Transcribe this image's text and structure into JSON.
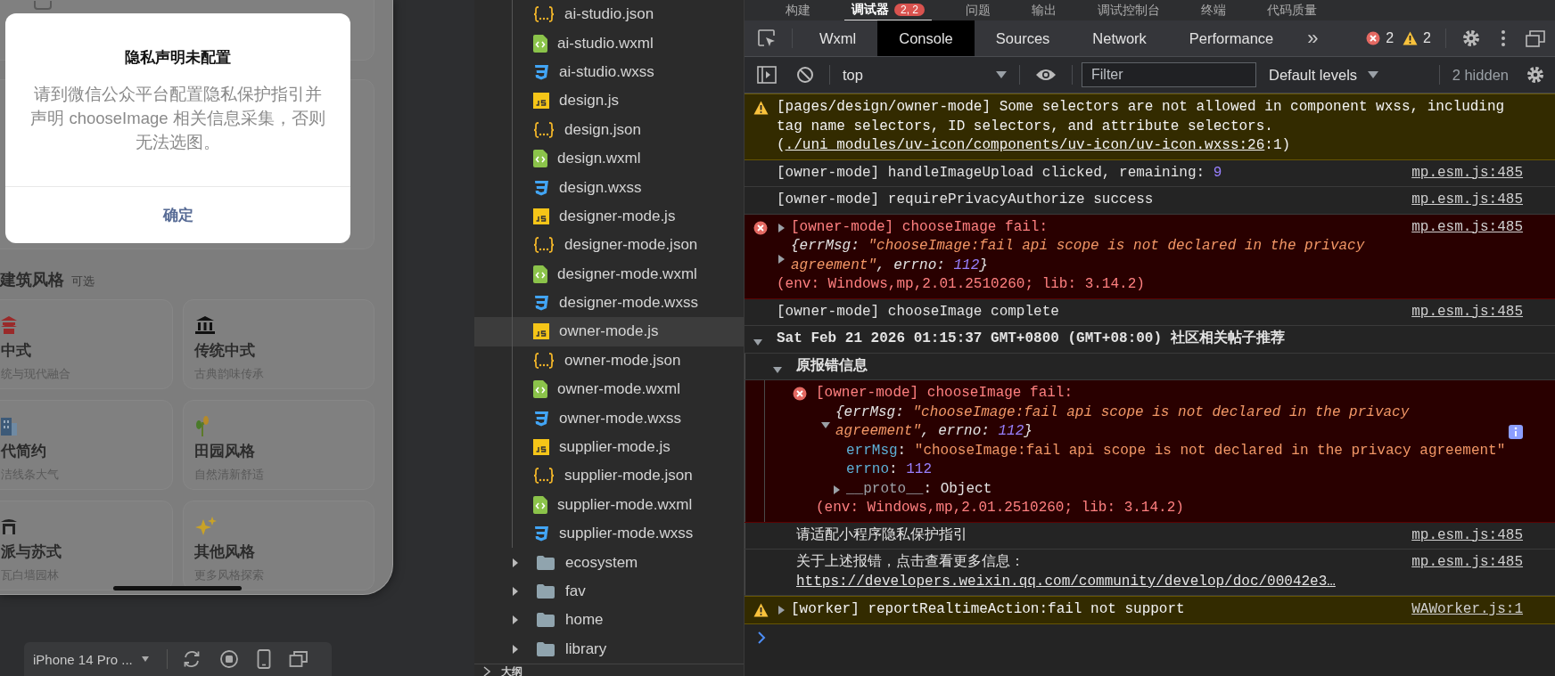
{
  "ide_tabs": [
    {
      "label": "构建",
      "selected": false
    },
    {
      "label": "调试器",
      "selected": true,
      "badge": "2, 2"
    },
    {
      "label": "问题",
      "selected": false
    },
    {
      "label": "输出",
      "selected": false
    },
    {
      "label": "调试控制台",
      "selected": false
    },
    {
      "label": "终端",
      "selected": false
    },
    {
      "label": "代码质量",
      "selected": false
    }
  ],
  "simulator": {
    "section_title": "建筑风格",
    "section_hint": "可选",
    "styles": [
      {
        "title": "中式",
        "subtitle": "统与现代融合",
        "kind": "pagoda"
      },
      {
        "title": "传统中式",
        "subtitle": "古典韵味传承",
        "kind": "temple"
      },
      {
        "title": "代简约",
        "subtitle": "洁线条大气",
        "kind": "building"
      },
      {
        "title": "田园风格",
        "subtitle": "自然清新舒适",
        "kind": "plant"
      },
      {
        "title": "派与苏式",
        "subtitle": "瓦白墙园林",
        "kind": "garden"
      },
      {
        "title": "其他风格",
        "subtitle": "更多风格探索",
        "kind": "sparkles"
      }
    ],
    "dialog": {
      "title": "隐私声明未配置",
      "message": "请到微信公众平台配置隐私保护指引并声明 chooseImage 相关信息采集，否则无法选图。",
      "button": "确定"
    },
    "device": "iPhone 14 Pro ..."
  },
  "file_tree": [
    {
      "name": "ai-studio.json",
      "kind": "json",
      "selected": false
    },
    {
      "name": "ai-studio.wxml",
      "kind": "wxml",
      "selected": false
    },
    {
      "name": "ai-studio.wxss",
      "kind": "wxss",
      "selected": false
    },
    {
      "name": "design.js",
      "kind": "js",
      "selected": false
    },
    {
      "name": "design.json",
      "kind": "json",
      "selected": false
    },
    {
      "name": "design.wxml",
      "kind": "wxml",
      "selected": false
    },
    {
      "name": "design.wxss",
      "kind": "wxss",
      "selected": false
    },
    {
      "name": "designer-mode.js",
      "kind": "js",
      "selected": false
    },
    {
      "name": "designer-mode.json",
      "kind": "json",
      "selected": false
    },
    {
      "name": "designer-mode.wxml",
      "kind": "wxml",
      "selected": false
    },
    {
      "name": "designer-mode.wxss",
      "kind": "wxss",
      "selected": false
    },
    {
      "name": "owner-mode.js",
      "kind": "js",
      "selected": true
    },
    {
      "name": "owner-mode.json",
      "kind": "json",
      "selected": false
    },
    {
      "name": "owner-mode.wxml",
      "kind": "wxml",
      "selected": false
    },
    {
      "name": "owner-mode.wxss",
      "kind": "wxss",
      "selected": false
    },
    {
      "name": "supplier-mode.js",
      "kind": "js",
      "selected": false
    },
    {
      "name": "supplier-mode.json",
      "kind": "json",
      "selected": false
    },
    {
      "name": "supplier-mode.wxml",
      "kind": "wxml",
      "selected": false
    },
    {
      "name": "supplier-mode.wxss",
      "kind": "wxss",
      "selected": false
    },
    {
      "name": "ecosystem",
      "kind": "folder",
      "expanded": false,
      "selected": false
    },
    {
      "name": "fav",
      "kind": "folder",
      "expanded": false,
      "selected": false
    },
    {
      "name": "home",
      "kind": "folder",
      "expanded": false,
      "selected": false
    },
    {
      "name": "library",
      "kind": "folder",
      "expanded": false,
      "selected": false
    }
  ],
  "outline": "大纲",
  "devtools": {
    "tabs": [
      {
        "label": "Wxml",
        "selected": false
      },
      {
        "label": "Console",
        "selected": true
      },
      {
        "label": "Sources",
        "selected": false
      },
      {
        "label": "Network",
        "selected": false
      },
      {
        "label": "Performance",
        "selected": false
      }
    ],
    "more": "»",
    "errors": "2",
    "warnings": "2",
    "context": "top",
    "filter_placeholder": "Filter",
    "levels": "Default levels",
    "hidden": "2 hidden"
  },
  "console": {
    "messages": [
      {
        "kind": "warning",
        "text": "[pages/design/owner-mode] Some selectors are not allowed in component wxss, including tag name selectors, ID selectors, and attribute selectors.(",
        "link": "./uni_modules/uv-icon/components/uv-icon/uv-icon.wxss:26",
        "tail": ":1)"
      },
      {
        "kind": "log",
        "text": "[owner-mode] handleImageUpload clicked, remaining: ",
        "number": "9",
        "source": "mp.esm.js:485"
      },
      {
        "kind": "log",
        "text": "[owner-mode] requirePrivacyAuthorize success",
        "source": "mp.esm.js:485"
      },
      {
        "kind": "error",
        "expanded": false,
        "text": "[owner-mode] chooseImage fail:",
        "preview": [
          {
            "text": "{errMsg: ",
            "kind": "key"
          },
          {
            "text": "\"chooseImage:fail api scope is not declared in the privacy agreement\"",
            "kind": "string"
          },
          {
            "text": ", errno: ",
            "kind": "key"
          },
          {
            "text": "112",
            "kind": "number"
          },
          {
            "text": "}",
            "kind": "key"
          }
        ],
        "env": "(env: Windows,mp,2.01.2510260; lib: 3.14.2)",
        "source": "mp.esm.js:485"
      },
      {
        "kind": "log",
        "text": "[owner-mode] chooseImage complete",
        "source": "mp.esm.js:485"
      },
      {
        "kind": "group",
        "expanded": true,
        "title": "Sat Feb 21 2026 01:15:37 GMT+0800 (GMT+08:00) 社区相关帖子推荐",
        "children": [
          {
            "kind": "group",
            "expanded": true,
            "title": "原报错信息",
            "children": [
              {
                "kind": "error",
                "expanded": true,
                "text": "[owner-mode] chooseImage fail:",
                "preview": [
                  {
                    "text": "{errMsg: ",
                    "kind": "key"
                  },
                  {
                    "text": "\"chooseImage:fail api scope is not declared in the privacy agreement\"",
                    "kind": "string"
                  },
                  {
                    "text": ", errno: ",
                    "kind": "key"
                  },
                  {
                    "text": "112",
                    "kind": "number"
                  },
                  {
                    "text": "}",
                    "kind": "key"
                  }
                ],
                "properties": [
                  {
                    "segments": [
                      {
                        "text": "errMsg",
                        "kind": "prop"
                      },
                      {
                        "text": ": ",
                        "kind": "plain"
                      },
                      {
                        "text": "\"chooseImage:fail api scope is not declared in the privacy agreement\"",
                        "kind": "string"
                      }
                    ]
                  },
                  {
                    "segments": [
                      {
                        "text": "errno",
                        "kind": "prop"
                      },
                      {
                        "text": ": ",
                        "kind": "plain"
                      },
                      {
                        "text": "112",
                        "kind": "number"
                      }
                    ]
                  },
                  {
                    "expanded": false,
                    "segments": [
                      {
                        "text": "__proto__",
                        "kind": "dim"
                      },
                      {
                        "text": ": ",
                        "kind": "plain"
                      },
                      {
                        "text": "Object",
                        "kind": "plain"
                      }
                    ]
                  }
                ],
                "env": "(env: Windows,mp,2.01.2510260; lib: 3.14.2)"
              }
            ]
          },
          {
            "kind": "log",
            "text": "请适配小程序隐私保护指引",
            "source": "mp.esm.js:485"
          },
          {
            "kind": "log",
            "text": "关于上述报错，点击查看更多信息：",
            "link": "https://developers.weixin.qq.com/community/develop/doc/00042e3…",
            "source": "mp.esm.js:485"
          }
        ]
      },
      {
        "kind": "warning",
        "expanded": false,
        "text": "[worker] reportRealtimeAction:fail not support",
        "source": "WAWorker.js:1"
      }
    ]
  }
}
